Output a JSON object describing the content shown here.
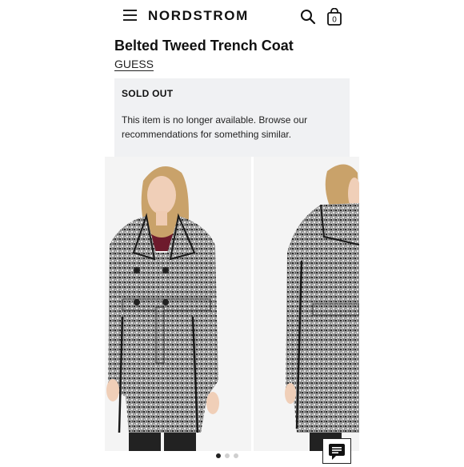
{
  "header": {
    "logo": "NORDSTROM",
    "menu_icon": "hamburger-menu-icon",
    "search_icon": "search-icon",
    "bag_icon": "shopping-bag-icon",
    "bag_count": "0"
  },
  "product": {
    "title": "Belted Tweed Trench Coat",
    "brand": "GUESS"
  },
  "availability": {
    "status": "SOLD OUT",
    "message": "This item is no longer available. Browse our recommendations for something similar."
  },
  "gallery": {
    "slides": [
      {
        "icon": "model-front-photo"
      },
      {
        "icon": "model-side-photo"
      }
    ],
    "dots": 3,
    "active_dot": 1
  },
  "chat": {
    "icon": "chat-icon"
  },
  "colors": {
    "panel_bg": "#f0f1f3",
    "text": "#111111"
  }
}
